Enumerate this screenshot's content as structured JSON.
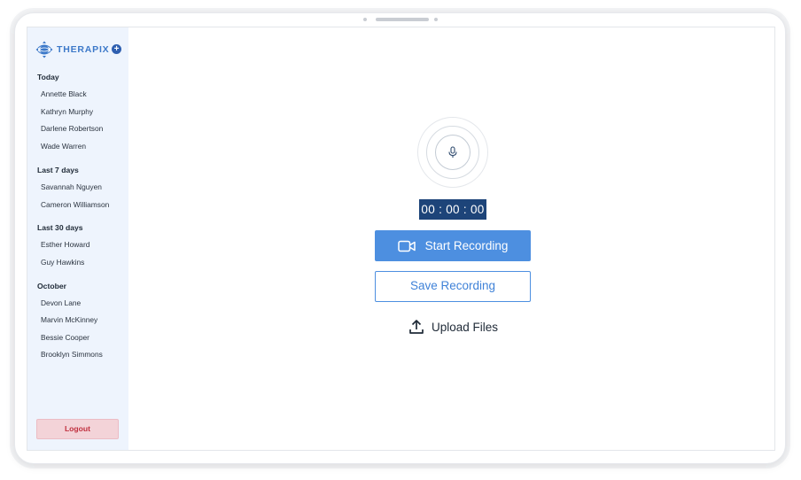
{
  "brand": {
    "name": "THERAPIX",
    "add_icon": "plus-circle-icon"
  },
  "sidebar": {
    "groups": [
      {
        "label": "Today",
        "items": [
          "Annette Black",
          "Kathryn Murphy",
          "Darlene Robertson",
          "Wade Warren"
        ]
      },
      {
        "label": "Last 7 days",
        "items": [
          "Savannah Nguyen",
          "Cameron Williamson"
        ]
      },
      {
        "label": "Last 30 days",
        "items": [
          "Esther Howard",
          "Guy Hawkins"
        ]
      },
      {
        "label": "October",
        "items": [
          "Devon Lane",
          "Marvin McKinney",
          "Bessie Cooper",
          "Brooklyn Simmons"
        ]
      }
    ],
    "logout_label": "Logout"
  },
  "recorder": {
    "mic_icon": "microphone-icon",
    "timer": "00 : 00 : 00",
    "start_label": "Start Recording",
    "start_icon": "video-camera-icon",
    "save_label": "Save Recording",
    "upload_label": "Upload Files",
    "upload_icon": "upload-icon"
  },
  "colors": {
    "primary": "#4d8fe0",
    "timer_bg": "#1d4479",
    "sidebar_bg": "#eef4fd",
    "logout_bg": "#f3d3d8",
    "logout_text": "#c0303f",
    "brand": "#3d79c9"
  }
}
